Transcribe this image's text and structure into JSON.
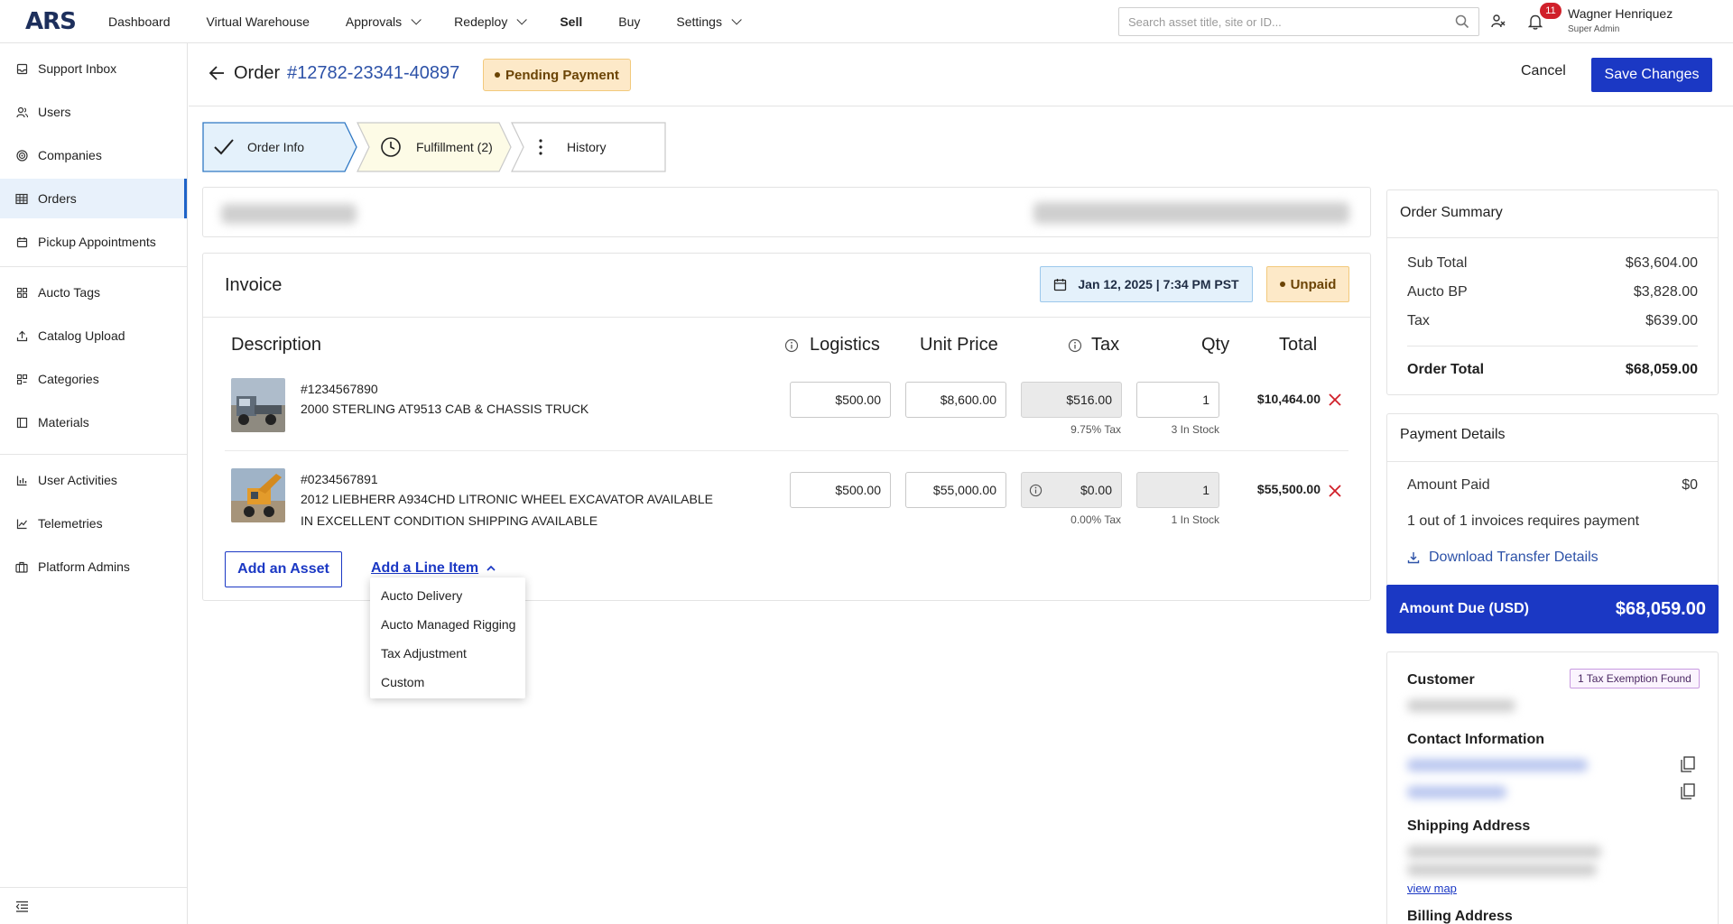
{
  "logo": "ARS",
  "nav": {
    "items": [
      {
        "label": "Dashboard",
        "chevron": false,
        "bold": false
      },
      {
        "label": "Virtual Warehouse",
        "chevron": false,
        "bold": false
      },
      {
        "label": "Approvals",
        "chevron": true,
        "bold": false
      },
      {
        "label": "Redeploy",
        "chevron": true,
        "bold": false
      },
      {
        "label": "Sell",
        "chevron": false,
        "bold": true
      },
      {
        "label": "Buy",
        "chevron": false,
        "bold": false
      },
      {
        "label": "Settings",
        "chevron": true,
        "bold": false
      }
    ],
    "search_placeholder": "Search asset title, site or ID...",
    "notification_count": "11",
    "user_name": "Wagner Henriquez",
    "user_role": "Super Admin"
  },
  "sidebar": {
    "items": [
      {
        "label": "Support Inbox",
        "icon": "inbox-icon"
      },
      {
        "label": "Users",
        "icon": "users-icon"
      },
      {
        "label": "Companies",
        "icon": "companies-icon"
      },
      {
        "label": "Orders",
        "icon": "orders-icon"
      },
      {
        "label": "Pickup Appointments",
        "icon": "calendar-icon"
      },
      {
        "label": "Aucto Tags",
        "icon": "tags-icon"
      },
      {
        "label": "Catalog Upload",
        "icon": "upload-icon"
      },
      {
        "label": "Categories",
        "icon": "categories-icon"
      },
      {
        "label": "Materials",
        "icon": "materials-icon"
      },
      {
        "label": "User Activities",
        "icon": "bar-chart-icon"
      },
      {
        "label": "Telemetries",
        "icon": "line-chart-icon"
      },
      {
        "label": "Platform Admins",
        "icon": "briefcase-icon"
      }
    ],
    "active": "Orders"
  },
  "header": {
    "order_label": "Order",
    "order_number": "#12782-23341-40897",
    "status": "Pending Payment",
    "cancel_label": "Cancel",
    "save_label": "Save Changes"
  },
  "steps": [
    {
      "label": "Order Info",
      "state": "complete"
    },
    {
      "label": "Fulfillment (2)",
      "state": "in-progress"
    },
    {
      "label": "History",
      "state": "pending"
    }
  ],
  "invoice": {
    "title": "Invoice",
    "date": "Jan 12, 2025 | 7:34 PM PST",
    "status": "Unpaid",
    "columns": {
      "description": "Description",
      "logistics": "Logistics",
      "unit_price": "Unit Price",
      "tax": "Tax",
      "qty": "Qty",
      "total": "Total"
    },
    "rows": [
      {
        "id": "#1234567890",
        "title": "2000 STERLING AT9513 CAB & CHASSIS TRUCK",
        "logistics": "$500.00",
        "unit_price": "$8,600.00",
        "tax": "$516.00",
        "tax_rate": "9.75% Tax",
        "qty": "1",
        "stock": "3 In Stock",
        "total": "$10,464.00"
      },
      {
        "id": "#0234567891",
        "title": "2012 LIEBHERR A934CHD LITRONIC WHEEL EXCAVATOR AVAILABLE IN EXCELLENT CONDITION SHIPPING AVAILABLE",
        "logistics": "$500.00",
        "unit_price": "$55,000.00",
        "tax": "$0.00",
        "tax_rate": "0.00% Tax",
        "qty": "1",
        "stock": "1 In Stock",
        "total": "$55,500.00"
      }
    ],
    "add_asset_label": "Add an Asset",
    "add_line_label": "Add a Line Item",
    "line_item_options": [
      "Aucto Delivery",
      "Aucto Managed Rigging",
      "Tax Adjustment",
      "Custom"
    ]
  },
  "order_summary": {
    "title": "Order Summary",
    "rows": [
      {
        "label": "Sub Total",
        "value": "$63,604.00"
      },
      {
        "label": "Aucto BP",
        "value": "$3,828.00"
      },
      {
        "label": "Tax",
        "value": "$639.00"
      }
    ],
    "total_label": "Order Total",
    "total_value": "$68,059.00"
  },
  "payment_details": {
    "title": "Payment Details",
    "amount_paid_label": "Amount Paid",
    "amount_paid_value": "$0",
    "invoice_note": "1 out of 1 invoices requires payment",
    "download_label": "Download Transfer Details",
    "amount_due_label": "Amount Due (USD)",
    "amount_due_value": "$68,059.00"
  },
  "customer": {
    "title": "Customer",
    "exemption": "1 Tax Exemption Found",
    "contact_title": "Contact Information",
    "shipping_title": "Shipping Address",
    "view_map": "view map",
    "billing_title": "Billing Address"
  },
  "colors": {
    "primary": "#1b38c4",
    "link": "#2d52a8",
    "pending_bg": "#fde9c8",
    "danger": "#d0202a"
  }
}
